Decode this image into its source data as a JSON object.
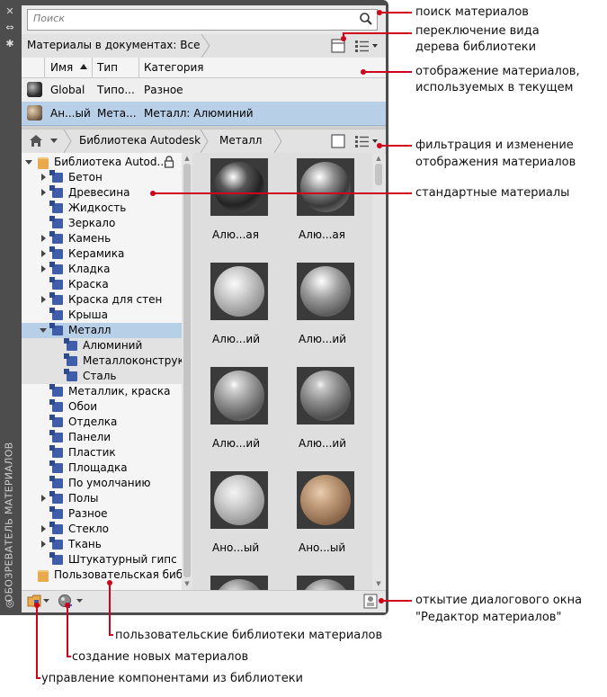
{
  "palette": {
    "vertical_title": "ОБОЗРЕВАТЕЛЬ МАТЕРИАЛОВ",
    "search": {
      "placeholder": "Поиск"
    },
    "document_header": {
      "breadcrumb": "Материалы в документах: Все"
    },
    "table": {
      "columns": [
        "Имя",
        "Тип",
        "Категория"
      ],
      "rows": [
        {
          "name": "Global",
          "type": "Типо...",
          "category": "Разное",
          "selected": false
        },
        {
          "name": "Ан...ый",
          "type": "Мета...",
          "category": "Металл: Алюминий",
          "selected": true
        }
      ]
    },
    "library_bar": {
      "breadcrumb": [
        "Библиотека Autodesk",
        "Металл"
      ]
    },
    "tree": [
      {
        "label": "Библиотека Autod...",
        "icon": "folder-icon",
        "expanded": true,
        "locked": true
      },
      {
        "label": "Бетон",
        "icon": "material-category-icon",
        "expandable": true
      },
      {
        "label": "Древесина",
        "icon": "material-category-icon",
        "expandable": true
      },
      {
        "label": "Жидкость",
        "icon": "material-category-icon"
      },
      {
        "label": "Зеркало",
        "icon": "material-category-icon"
      },
      {
        "label": "Камень",
        "icon": "material-category-icon",
        "expandable": true
      },
      {
        "label": "Керамика",
        "icon": "material-category-icon",
        "expandable": true
      },
      {
        "label": "Кладка",
        "icon": "material-category-icon",
        "expandable": true
      },
      {
        "label": "Краска",
        "icon": "material-category-icon"
      },
      {
        "label": "Краска для стен",
        "icon": "material-category-icon",
        "expandable": true
      },
      {
        "label": "Крыша",
        "icon": "material-category-icon"
      },
      {
        "label": "Металл",
        "icon": "material-category-icon",
        "expanded": true,
        "selected": true
      },
      {
        "label": "Алюминий",
        "icon": "material-category-icon",
        "child": true
      },
      {
        "label": "Металлоконструкц...",
        "icon": "material-category-icon",
        "child": true
      },
      {
        "label": "Сталь",
        "icon": "material-category-icon",
        "child": true
      },
      {
        "label": "Металлик, краска",
        "icon": "material-category-icon"
      },
      {
        "label": "Обои",
        "icon": "material-category-icon"
      },
      {
        "label": "Отделка",
        "icon": "material-category-icon"
      },
      {
        "label": "Панели",
        "icon": "material-category-icon"
      },
      {
        "label": "Пластик",
        "icon": "material-category-icon"
      },
      {
        "label": "Площадка",
        "icon": "material-category-icon"
      },
      {
        "label": "По умолчанию",
        "icon": "material-category-icon"
      },
      {
        "label": "Полы",
        "icon": "material-category-icon",
        "expandable": true
      },
      {
        "label": "Разное",
        "icon": "material-category-icon"
      },
      {
        "label": "Стекло",
        "icon": "material-category-icon",
        "expandable": true
      },
      {
        "label": "Ткань",
        "icon": "material-category-icon",
        "expandable": true
      },
      {
        "label": "Штукатурный гипс",
        "icon": "material-category-icon"
      },
      {
        "label": "Пользовательская биб...",
        "icon": "folder-icon"
      }
    ],
    "swatches": [
      {
        "caption": "Алю...ая",
        "style": "dark-chrome"
      },
      {
        "caption": "Алю...ая",
        "style": "chrome"
      },
      {
        "caption": "Алю...ий",
        "style": "satin"
      },
      {
        "caption": "Алю...ий",
        "style": "hammered"
      },
      {
        "caption": "Алю...ий",
        "style": "brushed"
      },
      {
        "caption": "Алю...ий",
        "style": "brushed-dark"
      },
      {
        "caption": "Ано...ый",
        "style": "speckled"
      },
      {
        "caption": "Ано...ый",
        "style": "bronze"
      }
    ]
  },
  "annotations": {
    "search": "поиск материалов",
    "tree_view_toggle_1": "переключение вида",
    "tree_view_toggle_2": "дерева библиотеки",
    "doc_materials_1": "отображение материалов,",
    "doc_materials_2": "используемых в текущем",
    "filter_1": "фильтрация и изменение",
    "filter_2": "отображения материалов",
    "standard_materials": "стандартные материалы",
    "editor_1": "откытие диалогового окна",
    "editor_2": "\"Редактор материалов\"",
    "user_libraries": "пользовательские библиотеки материалов",
    "create_materials": "создание новых материалов",
    "manage_components": "управление компонентами из библиотеки"
  },
  "colors": {
    "annotation_line": "#d0021b",
    "selection": "#b8cfe8",
    "palette_frame": "#4d4d4d"
  }
}
